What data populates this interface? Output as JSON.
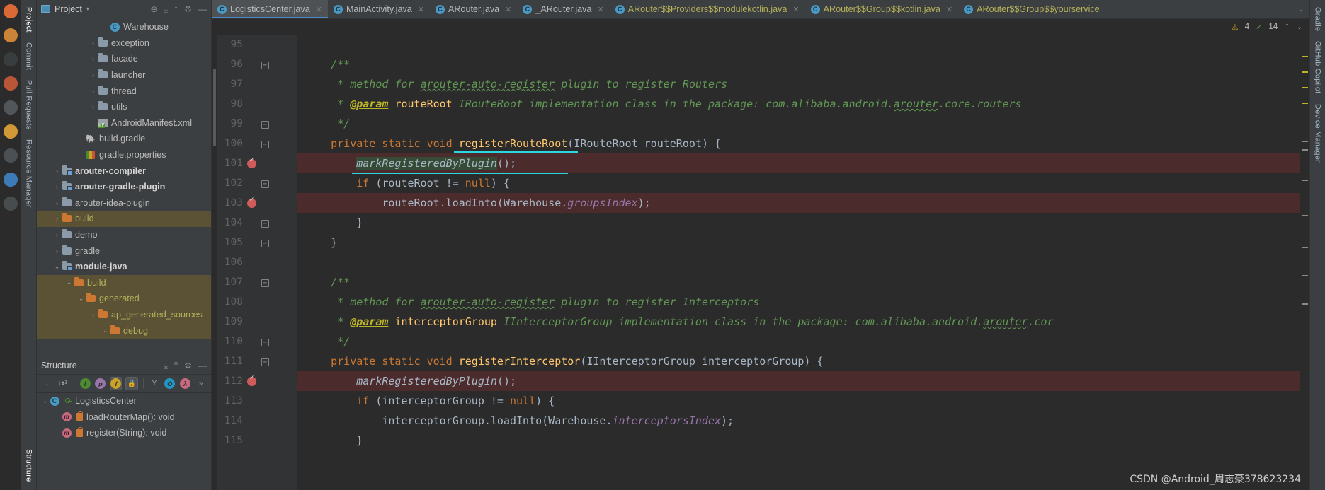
{
  "window": {
    "title": "LogisticsCenter.java"
  },
  "os_strip": {
    "name": "ubuntu-launcher",
    "dots": [
      {
        "name": "launcher-icon-firefox",
        "color": "#e8703a"
      },
      {
        "name": "launcher-icon-files",
        "color": "#d98b3a"
      },
      {
        "name": "launcher-icon-terminal",
        "color": "#3c3f41"
      },
      {
        "name": "launcher-icon-idea",
        "color": "#c65a3a"
      },
      {
        "name": "launcher-icon-settings",
        "color": "#555a5e"
      },
      {
        "name": "launcher-icon-music",
        "color": "#e0a23a"
      },
      {
        "name": "launcher-icon-photos",
        "color": "#4e5458"
      },
      {
        "name": "launcher-icon-store",
        "color": "#3f82c4"
      },
      {
        "name": "launcher-icon-help",
        "color": "#4a4f53"
      }
    ]
  },
  "left_tool_tabs": [
    {
      "label": "Project",
      "icon": "project-icon",
      "active": true
    },
    {
      "label": "Commit",
      "icon": "commit-icon",
      "active": false
    },
    {
      "label": "Pull Requests",
      "icon": "pull-request-icon",
      "active": false
    },
    {
      "label": "Resource Manager",
      "icon": "resource-icon",
      "active": false
    }
  ],
  "left_tool_tabs_bottom": [
    {
      "label": "Structure",
      "icon": "structure-icon",
      "active": true
    }
  ],
  "right_tool_tabs": [
    {
      "label": "Gradle",
      "icon": "gradle-icon"
    },
    {
      "label": "GitHub Copilot",
      "icon": "copilot-icon"
    },
    {
      "label": "Device Manager",
      "icon": "device-icon"
    }
  ],
  "project_panel": {
    "title": "Project",
    "dropdown_caret": "▾",
    "icons": [
      {
        "name": "locate-file-icon",
        "glyph": "⊕"
      },
      {
        "name": "expand-all-icon",
        "glyph": "⤓"
      },
      {
        "name": "collapse-all-icon",
        "glyph": "⤒"
      },
      {
        "name": "settings-gear-icon",
        "glyph": "⚙"
      },
      {
        "name": "hide-panel-icon",
        "glyph": "—"
      }
    ],
    "tree": [
      {
        "label": "Warehouse",
        "indent": 5,
        "icon": "class-icon",
        "arrow": "none",
        "style": "plain"
      },
      {
        "label": "exception",
        "indent": 4,
        "icon": "folder-pkg",
        "arrow": ">",
        "style": "plain"
      },
      {
        "label": "facade",
        "indent": 4,
        "icon": "folder-pkg",
        "arrow": ">",
        "style": "plain"
      },
      {
        "label": "launcher",
        "indent": 4,
        "icon": "folder-pkg",
        "arrow": ">",
        "style": "plain"
      },
      {
        "label": "thread",
        "indent": 4,
        "icon": "folder-pkg",
        "arrow": ">",
        "style": "plain"
      },
      {
        "label": "utils",
        "indent": 4,
        "icon": "folder-pkg",
        "arrow": ">",
        "style": "plain"
      },
      {
        "label": "AndroidManifest.xml",
        "indent": 4,
        "icon": "manifest-icon",
        "arrow": "none",
        "style": "plain"
      },
      {
        "label": "build.gradle",
        "indent": 3,
        "icon": "gradle-icon",
        "arrow": "none",
        "style": "plain"
      },
      {
        "label": "gradle.properties",
        "indent": 3,
        "icon": "properties-icon",
        "arrow": "none",
        "style": "plain"
      },
      {
        "label": "arouter-compiler",
        "indent": 1,
        "icon": "module-folder",
        "arrow": ">",
        "style": "bold"
      },
      {
        "label": "arouter-gradle-plugin",
        "indent": 1,
        "icon": "module-folder",
        "arrow": ">",
        "style": "bold"
      },
      {
        "label": "arouter-idea-plugin",
        "indent": 1,
        "icon": "folder",
        "arrow": ">",
        "style": "plain"
      },
      {
        "label": "build",
        "indent": 1,
        "icon": "folder-orange",
        "arrow": ">",
        "style": "olive",
        "selected": true
      },
      {
        "label": "demo",
        "indent": 1,
        "icon": "folder",
        "arrow": ">",
        "style": "plain"
      },
      {
        "label": "gradle",
        "indent": 1,
        "icon": "folder",
        "arrow": ">",
        "style": "plain"
      },
      {
        "label": "module-java",
        "indent": 1,
        "icon": "module-icon",
        "arrow": "v",
        "style": "bold"
      },
      {
        "label": "build",
        "indent": 2,
        "icon": "folder-orange",
        "arrow": "v",
        "style": "olive",
        "selected": true
      },
      {
        "label": "generated",
        "indent": 3,
        "icon": "folder-orange",
        "arrow": "v",
        "style": "olive",
        "selected": true
      },
      {
        "label": "ap_generated_sources",
        "indent": 4,
        "icon": "folder-orange",
        "arrow": "v",
        "style": "olive",
        "selected": true
      },
      {
        "label": "debug",
        "indent": 5,
        "icon": "folder-orange",
        "arrow": "v",
        "style": "olive",
        "selected": true
      }
    ]
  },
  "structure_panel": {
    "title": "Structure",
    "header_icons": [
      {
        "name": "expand-all-icon",
        "glyph": "⤓"
      },
      {
        "name": "collapse-all-icon",
        "glyph": "⤒"
      },
      {
        "name": "settings-gear-icon",
        "glyph": "⚙"
      },
      {
        "name": "hide-panel-icon",
        "glyph": "—"
      }
    ],
    "toolbar": [
      {
        "name": "sort-by-visibility-button",
        "glyph": "↓",
        "color": "#c9c9c9",
        "active": false
      },
      {
        "name": "sort-alphabetically-button",
        "glyph": "↓ᴀᶻ",
        "color": "#c9c9c9",
        "active": false
      },
      {
        "name": "show-inherited-button",
        "glyph": "I",
        "color": "#4d8b31",
        "active": false
      },
      {
        "name": "show-properties-button",
        "glyph": "p",
        "color": "#9876aa",
        "active": false
      },
      {
        "name": "show-fields-button",
        "glyph": "f",
        "color": "#c9a227",
        "active": true
      },
      {
        "name": "show-non-public-button",
        "glyph": "🔒",
        "color": "#cc7832",
        "active": true
      },
      {
        "name": "show-anonymous-button",
        "glyph": "Y",
        "color": "#9aa0a6",
        "active": false
      },
      {
        "name": "show-interfaces-button",
        "glyph": "O",
        "color": "#2196c4",
        "active": false
      },
      {
        "name": "show-lambdas-button",
        "glyph": "λ",
        "color": "#c76a80",
        "active": false
      },
      {
        "name": "more-options-button",
        "glyph": "»",
        "color": "#9aa0a6",
        "active": false
      }
    ],
    "items": [
      {
        "label": "LogisticsCenter",
        "indent": 0,
        "icon": "class-icon",
        "arrow": "v",
        "badge": "key-icon"
      },
      {
        "label": "loadRouterMap(): void",
        "indent": 1,
        "icon": "method-icon",
        "arrow": "none",
        "badge": "lock-icon"
      },
      {
        "label": "register(String): void",
        "indent": 1,
        "icon": "method-icon",
        "arrow": "none",
        "badge": "lock-icon"
      }
    ]
  },
  "editor_tabs": [
    {
      "label": "LogisticsCenter.java",
      "icon": "java-class-icon",
      "active": true,
      "color": "normal",
      "closable": true
    },
    {
      "label": "MainActivity.java",
      "icon": "java-class-icon",
      "active": false,
      "color": "normal",
      "closable": true
    },
    {
      "label": "ARouter.java",
      "icon": "java-class-icon",
      "active": false,
      "color": "normal",
      "closable": true
    },
    {
      "label": "_ARouter.java",
      "icon": "java-class-icon",
      "active": false,
      "color": "normal",
      "closable": true
    },
    {
      "label": "ARouter$$Providers$$modulekotlin.java",
      "icon": "java-class-icon",
      "active": false,
      "color": "yellow",
      "closable": true
    },
    {
      "label": "ARouter$$Group$$kotlin.java",
      "icon": "java-class-icon",
      "active": false,
      "color": "yellow",
      "closable": true
    },
    {
      "label": "ARouter$$Group$$yourservice",
      "icon": "java-class-icon",
      "active": false,
      "color": "yellow",
      "closable": false
    }
  ],
  "tabbar_overflow": {
    "name": "tab-list-chevron",
    "glyph": "⌄"
  },
  "inspection_widget": {
    "warning_glyph": "⚠",
    "warning_count": "4",
    "ok_glyph": "✓",
    "ok_count": "14",
    "prev_glyph": "⌃",
    "next_glyph": "⌄"
  },
  "code": {
    "first_line": 95,
    "lines": [
      {
        "num": 95,
        "fold": "",
        "bp": false,
        "hl": false,
        "tokens": []
      },
      {
        "num": 96,
        "fold": "minus",
        "bp": false,
        "hl": false,
        "tokens": [
          {
            "t": "    ",
            "c": "txt"
          },
          {
            "t": "/**",
            "c": "cmt"
          }
        ]
      },
      {
        "num": 97,
        "fold": "",
        "bp": false,
        "hl": false,
        "tokens": [
          {
            "t": "     * method for ",
            "c": "cmt"
          },
          {
            "t": "arouter-auto-register",
            "c": "cmt squig"
          },
          {
            "t": " plugin to register Routers",
            "c": "cmt"
          }
        ]
      },
      {
        "num": 98,
        "fold": "",
        "bp": false,
        "hl": false,
        "tokens": [
          {
            "t": "     * ",
            "c": "cmt"
          },
          {
            "t": "@param",
            "c": "tag"
          },
          {
            "t": " ",
            "c": "cmt"
          },
          {
            "t": "routeRoot",
            "c": "mth-u"
          },
          {
            "t": " IRouteRoot implementation class in the package: com.alibaba.android.",
            "c": "cmt"
          },
          {
            "t": "arouter",
            "c": "cmt squig"
          },
          {
            "t": ".core.routers",
            "c": "cmt"
          }
        ]
      },
      {
        "num": 99,
        "fold": "minus",
        "bp": false,
        "hl": false,
        "tokens": [
          {
            "t": "     */",
            "c": "cmt"
          }
        ]
      },
      {
        "num": 100,
        "fold": "minus",
        "bp": false,
        "hl": false,
        "tokens": [
          {
            "t": "    ",
            "c": "txt"
          },
          {
            "t": "private static void ",
            "c": "kw"
          },
          {
            "t": "registerRouteRoot",
            "c": "mth uline"
          },
          {
            "t": "(",
            "c": "txt"
          },
          {
            "t": "IRouteRoot routeRoot",
            "c": "txt"
          },
          {
            "t": ") {",
            "c": "txt"
          }
        ]
      },
      {
        "num": 101,
        "fold": "",
        "bp": true,
        "hl": true,
        "tokens": [
          {
            "t": "        ",
            "c": "txt"
          },
          {
            "t": "markRegisteredByPlugin",
            "c": "call-it hl-green"
          },
          {
            "t": "();",
            "c": "txt"
          }
        ]
      },
      {
        "num": 102,
        "fold": "minus",
        "bp": false,
        "hl": false,
        "tokens": [
          {
            "t": "        ",
            "c": "txt"
          },
          {
            "t": "if",
            "c": "kw"
          },
          {
            "t": " (routeRoot != ",
            "c": "txt"
          },
          {
            "t": "null",
            "c": "kw"
          },
          {
            "t": ") {",
            "c": "txt"
          }
        ]
      },
      {
        "num": 103,
        "fold": "",
        "bp": true,
        "hl": true,
        "tokens": [
          {
            "t": "            routeRoot.loadInto(Warehouse.",
            "c": "txt"
          },
          {
            "t": "groupsIndex",
            "c": "fld"
          },
          {
            "t": ");",
            "c": "txt"
          }
        ]
      },
      {
        "num": 104,
        "fold": "minus",
        "bp": false,
        "hl": false,
        "tokens": [
          {
            "t": "        }",
            "c": "txt"
          }
        ]
      },
      {
        "num": 105,
        "fold": "minus",
        "bp": false,
        "hl": false,
        "tokens": [
          {
            "t": "    }",
            "c": "txt"
          }
        ]
      },
      {
        "num": 106,
        "fold": "",
        "bp": false,
        "hl": false,
        "tokens": []
      },
      {
        "num": 107,
        "fold": "minus",
        "bp": false,
        "hl": false,
        "tokens": [
          {
            "t": "    ",
            "c": "txt"
          },
          {
            "t": "/**",
            "c": "cmt"
          }
        ]
      },
      {
        "num": 108,
        "fold": "",
        "bp": false,
        "hl": false,
        "tokens": [
          {
            "t": "     * method for ",
            "c": "cmt"
          },
          {
            "t": "arouter-auto-register",
            "c": "cmt squig"
          },
          {
            "t": " plugin to register Interceptors",
            "c": "cmt"
          }
        ]
      },
      {
        "num": 109,
        "fold": "",
        "bp": false,
        "hl": false,
        "tokens": [
          {
            "t": "     * ",
            "c": "cmt"
          },
          {
            "t": "@param",
            "c": "tag"
          },
          {
            "t": " ",
            "c": "cmt"
          },
          {
            "t": "interceptorGroup",
            "c": "mth-u"
          },
          {
            "t": " IInterceptorGroup implementation class in the package: com.alibaba.android.",
            "c": "cmt"
          },
          {
            "t": "arouter",
            "c": "cmt squig"
          },
          {
            "t": ".cor",
            "c": "cmt"
          }
        ]
      },
      {
        "num": 110,
        "fold": "minus",
        "bp": false,
        "hl": false,
        "tokens": [
          {
            "t": "     */",
            "c": "cmt"
          }
        ]
      },
      {
        "num": 111,
        "fold": "minus",
        "bp": false,
        "hl": false,
        "tokens": [
          {
            "t": "    ",
            "c": "txt"
          },
          {
            "t": "private static void ",
            "c": "kw"
          },
          {
            "t": "registerInterceptor",
            "c": "mth"
          },
          {
            "t": "(IInterceptorGroup interceptorGroup) {",
            "c": "txt"
          }
        ]
      },
      {
        "num": 112,
        "fold": "",
        "bp": true,
        "hl": true,
        "tokens": [
          {
            "t": "        ",
            "c": "txt"
          },
          {
            "t": "markRegisteredByPlugin",
            "c": "call-it"
          },
          {
            "t": "();",
            "c": "txt"
          }
        ]
      },
      {
        "num": 113,
        "fold": "",
        "bp": false,
        "hl": false,
        "tokens": [
          {
            "t": "        ",
            "c": "txt"
          },
          {
            "t": "if",
            "c": "kw"
          },
          {
            "t": " (interceptorGroup != ",
            "c": "txt"
          },
          {
            "t": "null",
            "c": "kw"
          },
          {
            "t": ") {",
            "c": "txt"
          }
        ]
      },
      {
        "num": 114,
        "fold": "",
        "bp": false,
        "hl": false,
        "tokens": [
          {
            "t": "            interceptorGroup.loadInto(Warehouse.",
            "c": "txt"
          },
          {
            "t": "interceptorsIndex",
            "c": "fld"
          },
          {
            "t": ");",
            "c": "txt"
          }
        ]
      },
      {
        "num": 115,
        "fold": "",
        "bp": false,
        "hl": false,
        "tokens": [
          {
            "t": "        }",
            "c": "txt"
          }
        ]
      }
    ]
  },
  "watermark": {
    "text": "CSDN @Android_周志豪378623234"
  },
  "colors": {
    "accent": "#4a88c7",
    "tab_yellow": "#b5b05a",
    "breakpoint_red": "#cf5b5b",
    "line_highlight": "#4b2b2b",
    "selection_olive": "#5b5236",
    "comment_green": "#629755",
    "keyword_orange": "#cc7832",
    "method_yellow": "#ffc66d",
    "field_purple": "#9876aa",
    "underline_cyan": "#29d8e0"
  }
}
